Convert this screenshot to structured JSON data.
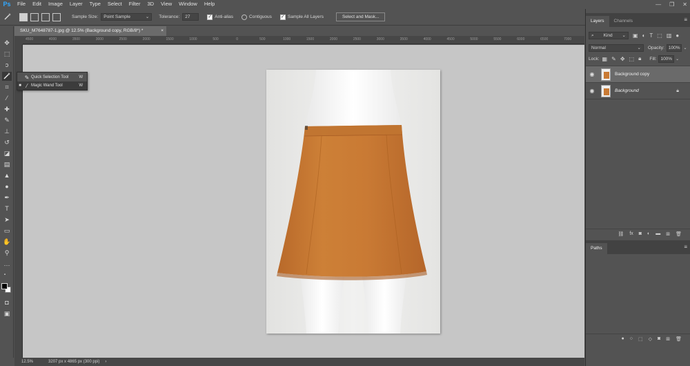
{
  "app": {
    "logo": "Ps"
  },
  "menu": [
    "File",
    "Edit",
    "Image",
    "Layer",
    "Type",
    "Select",
    "Filter",
    "3D",
    "View",
    "Window",
    "Help"
  ],
  "window_controls": {
    "minimize": "—",
    "restore": "❐",
    "close": "✕"
  },
  "options": {
    "sample_size_label": "Sample Size:",
    "sample_size_value": "Point Sample",
    "tolerance_label": "Tolerance:",
    "tolerance_value": "27",
    "anti_alias_label": "Anti-alias",
    "anti_alias_checked": true,
    "contiguous_label": "Contiguous",
    "contiguous_checked": false,
    "sample_all_label": "Sample All Layers",
    "sample_all_checked": true,
    "select_mask_label": "Select and Mask..."
  },
  "document": {
    "tab_title": "SKU_M7648787-1.jpg @ 12.5% (Background copy, RGB/8*) *",
    "close_glyph": "×"
  },
  "ruler_top_labels": [
    "4500",
    "4000",
    "3500",
    "3000",
    "2500",
    "2000",
    "1500",
    "1000",
    "500",
    "0",
    "500",
    "1000",
    "1500",
    "2000",
    "2500",
    "3000",
    "3500",
    "4000",
    "4500",
    "5000",
    "5500",
    "6000",
    "6500",
    "7000"
  ],
  "flyout": {
    "items": [
      {
        "label": "Quick Selection Tool",
        "key": "W",
        "bullet": ""
      },
      {
        "label": "Magic Wand Tool",
        "key": "W",
        "bullet": "■"
      }
    ]
  },
  "status": {
    "zoom": "12.5%",
    "info": "3207 px x 4865 px (300 ppi)",
    "arrow": "›"
  },
  "layers_panel": {
    "tabs": [
      "Layers",
      "Channels"
    ],
    "kind_label": "Kind",
    "blend_mode": "Normal",
    "opacity_label": "Opacity:",
    "opacity_value": "100%",
    "lock_label": "Lock:",
    "fill_label": "Fill:",
    "fill_value": "100%",
    "layers": [
      {
        "name": "Background copy"
      },
      {
        "name": "Background"
      }
    ]
  },
  "paths_panel": {
    "tab": "Paths"
  },
  "colors": {
    "skirt": "#c97a34",
    "accent": "#31a8ff"
  }
}
